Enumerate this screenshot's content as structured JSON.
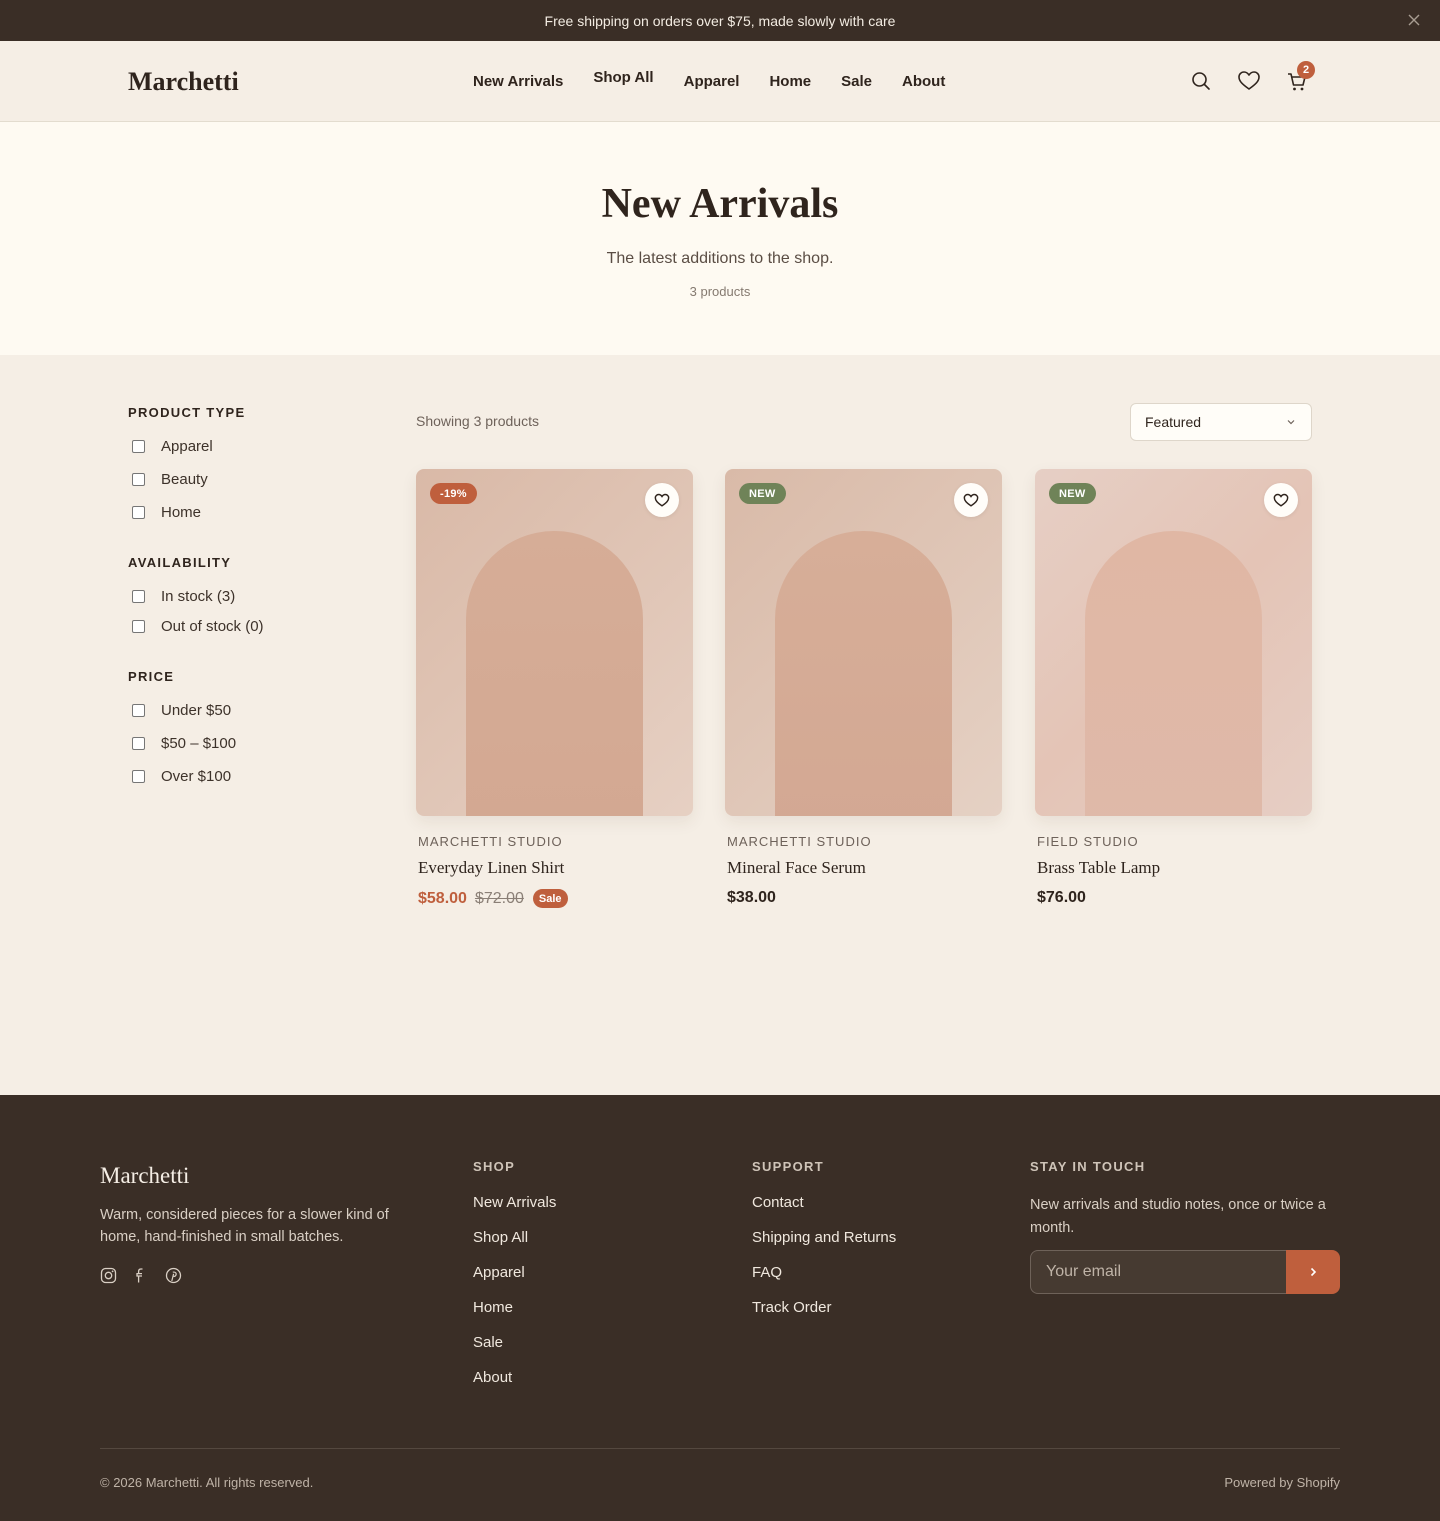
{
  "announcement": {
    "text": "Free shipping on orders over $75, made slowly with care"
  },
  "header": {
    "logo": "Marchetti",
    "nav": [
      "New Arrivals",
      "Shop All",
      "Apparel",
      "Home",
      "Sale",
      "About"
    ],
    "cart_count": "2"
  },
  "hero": {
    "title": "New Arrivals",
    "subtitle": "The latest additions to the shop.",
    "count": "3 products"
  },
  "filters": {
    "groups": [
      {
        "title": "PRODUCT TYPE",
        "options": [
          "Apparel",
          "Beauty",
          "Home"
        ]
      },
      {
        "title": "AVAILABILITY",
        "options": [
          "In stock (3)",
          "Out of stock (0)"
        ]
      },
      {
        "title": "PRICE",
        "options": [
          "Under $50",
          "$50 – $100",
          "Over $100"
        ]
      }
    ]
  },
  "toolbar": {
    "showing": "Showing 3 products",
    "sort": "Featured"
  },
  "products": [
    {
      "vendor": "MARCHETTI STUDIO",
      "name": "Everyday Linen Shirt",
      "price": "$58.00",
      "compare": "$72.00",
      "badge": "-19%",
      "badge_color": "#bf5f3d",
      "sale_label": "Sale"
    },
    {
      "vendor": "MARCHETTI STUDIO",
      "name": "Mineral Face Serum",
      "price": "$38.00",
      "badge": "NEW",
      "badge_color": "#6f8358"
    },
    {
      "vendor": "FIELD STUDIO",
      "name": "Brass Table Lamp",
      "price": "$76.00",
      "badge": "NEW",
      "badge_color": "#6f8358"
    }
  ],
  "footer": {
    "logo": "Marchetti",
    "description": "Warm, considered pieces for a slower kind of home, hand-finished in small batches.",
    "social": [
      "instagram-icon",
      "facebook-icon",
      "pinterest-icon"
    ],
    "shop": {
      "title": "SHOP",
      "links": [
        "New Arrivals",
        "Shop All",
        "Apparel",
        "Home",
        "Sale",
        "About"
      ]
    },
    "support": {
      "title": "SUPPORT",
      "links": [
        "Contact",
        "Shipping and Returns",
        "FAQ",
        "Track Order"
      ]
    },
    "newsletter": {
      "title": "STAY IN TOUCH",
      "text": "New arrivals and studio notes, once or twice a month.",
      "placeholder": "Your email"
    },
    "copyright": "© 2026 Marchetti. All rights reserved.",
    "powered": "Powered by Shopify"
  },
  "colors": {
    "accent": "#bf5f3d",
    "new_badge": "#6f8358",
    "dark": "#3a2e26",
    "cream": "#f5eee5"
  }
}
